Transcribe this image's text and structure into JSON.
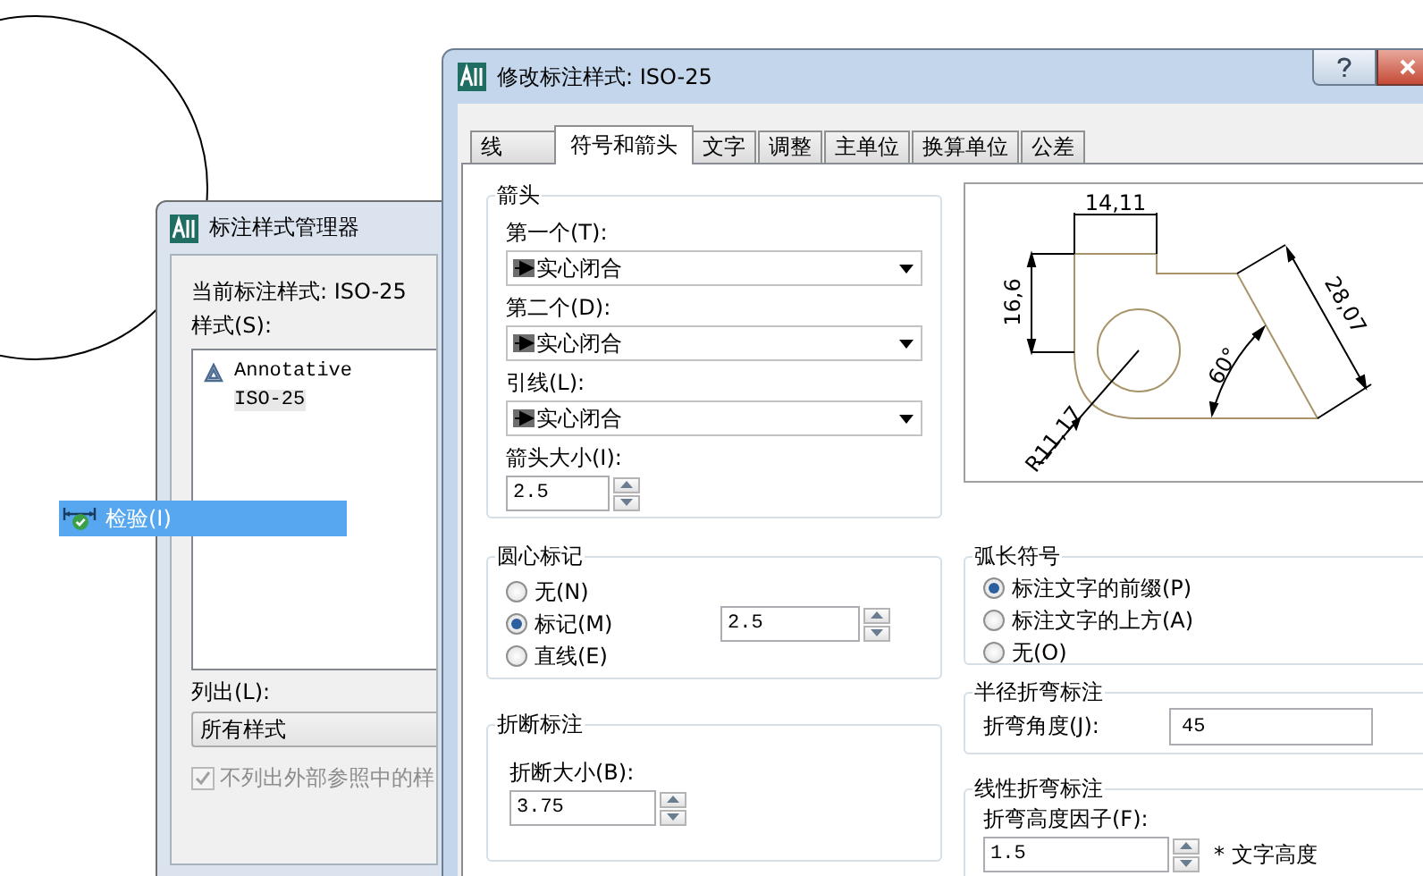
{
  "style_manager": {
    "title": "标注样式管理器",
    "current_style": "当前标注样式: ISO-25",
    "styles_label": "样式(S):",
    "styles": [
      {
        "name": "Annotative",
        "kind": "annotative",
        "selected": false
      },
      {
        "name": "ISO-25",
        "kind": "plain",
        "selected": true
      }
    ],
    "list_label": "列出(L):",
    "list_value": "所有样式",
    "exclude_xref": {
      "label": "不列出外部参照中的样",
      "checked": true,
      "disabled": true
    }
  },
  "context_item": {
    "label": "检验(I)",
    "selected": true
  },
  "dialog": {
    "title": "修改标注样式: ISO-25",
    "tabs": [
      {
        "label": "线",
        "selected": false
      },
      {
        "label": "符号和箭头",
        "selected": true
      },
      {
        "label": "文字",
        "selected": false
      },
      {
        "label": "调整",
        "selected": false
      },
      {
        "label": "主单位",
        "selected": false
      },
      {
        "label": "换算单位",
        "selected": false
      },
      {
        "label": "公差",
        "selected": false
      }
    ],
    "arrowheads": {
      "title": "箭头",
      "fields": [
        {
          "label": "第一个(T):",
          "value": "实心闭合"
        },
        {
          "label": "第二个(D):",
          "value": "实心闭合"
        },
        {
          "label": "引线(L):",
          "value": "实心闭合"
        }
      ],
      "size_label": "箭头大小(I):",
      "size": "2.5"
    },
    "center_marks": {
      "title": "圆心标记",
      "options": [
        {
          "label": "无(N)",
          "selected": false
        },
        {
          "label": "标记(M)",
          "selected": true
        },
        {
          "label": "直线(E)",
          "selected": false
        }
      ],
      "size": "2.5"
    },
    "dim_break": {
      "title": "折断标注",
      "size_label": "折断大小(B):",
      "size": "3.75"
    },
    "preview": {
      "labels": [
        "14,11",
        "16,6",
        "28,07",
        "60°",
        "R11,17"
      ]
    },
    "arc_length": {
      "title": "弧长符号",
      "options": [
        {
          "label": "标注文字的前缀(P)",
          "selected": true
        },
        {
          "label": "标注文字的上方(A)",
          "selected": false
        },
        {
          "label": "无(O)",
          "selected": false
        }
      ]
    },
    "radius_jog": {
      "title": "半径折弯标注",
      "angle_label": "折弯角度(J):",
      "angle": "45"
    },
    "linear_jog": {
      "title": "线性折弯标注",
      "factor_label": "折弯高度因子(F):",
      "factor": "1.5",
      "unit": "* 文字高度"
    }
  }
}
